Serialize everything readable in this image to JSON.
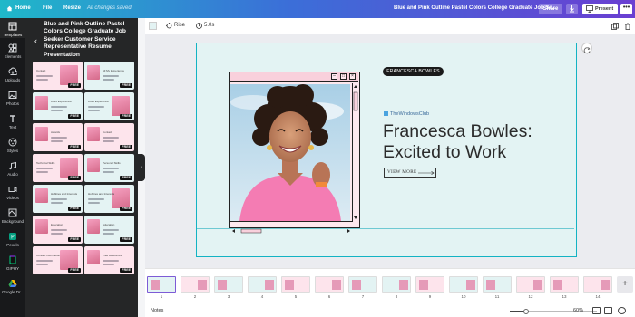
{
  "topbar": {
    "home": "Home",
    "file": "File",
    "resize": "Resize",
    "saved_status": "All changes saved",
    "doc_title": "Blue and Pink Outline Pastel Colors College Graduate Job Se...",
    "share": "Share",
    "present": "Present",
    "more": "•••"
  },
  "siderail": {
    "items": [
      {
        "label": "Templates",
        "icon": "templates-icon",
        "active": true
      },
      {
        "label": "Elements",
        "icon": "elements-icon"
      },
      {
        "label": "Uploads",
        "icon": "uploads-icon"
      },
      {
        "label": "Photos",
        "icon": "photos-icon"
      },
      {
        "label": "Text",
        "icon": "text-icon"
      },
      {
        "label": "Styles",
        "icon": "styles-icon"
      },
      {
        "label": "Audio",
        "icon": "audio-icon"
      },
      {
        "label": "Videos",
        "icon": "videos-icon"
      },
      {
        "label": "Background",
        "icon": "background-icon"
      },
      {
        "label": "Pexels",
        "icon": "pexels-icon"
      },
      {
        "label": "GIPHY",
        "icon": "giphy-icon"
      },
      {
        "label": "Google Dr...",
        "icon": "google-drive-icon"
      }
    ]
  },
  "panel": {
    "title": "Blue and Pink Outline Pastel Colors College Graduate Job Seeker Customer Service Representative Resume Presentation",
    "badge": "FREE",
    "thumbs": [
      {
        "label": "Contact",
        "bg": "#fde4ec"
      },
      {
        "label": "All My Experience",
        "bg": "#e4f3f3"
      },
      {
        "label": "Work Experience",
        "bg": "#e4f3f3"
      },
      {
        "label": "Work Experience",
        "bg": "#e4f3f3"
      },
      {
        "label": "Awards",
        "bg": "#fde4ec"
      },
      {
        "label": "Contact",
        "bg": "#fde4ec"
      },
      {
        "label": "Technical Skills",
        "bg": "#fde4ec"
      },
      {
        "label": "Personal Skills",
        "bg": "#e4f3f3"
      },
      {
        "label": "Hobbies and Interests",
        "bg": "#e4f3f3"
      },
      {
        "label": "Hobbies and Interests",
        "bg": "#e4f3f3"
      },
      {
        "label": "Education",
        "bg": "#fde4ec"
      },
      {
        "label": "Education",
        "bg": "#e4f3f3"
      },
      {
        "label": "Contact Information",
        "bg": "#fde4ec"
      },
      {
        "label": "Free Resources",
        "bg": "#fde4ec"
      }
    ]
  },
  "toolbar": {
    "animate": "Rise",
    "duration": "5.0s"
  },
  "slide": {
    "name_pill": "FRANCESCA BOWLES",
    "watermark": "TheWindowsClub",
    "headline_line1": "Francesca Bowles:",
    "headline_line2": "Excited to Work",
    "cta": "VIEW MORE",
    "window_buttons": [
      "–",
      "□",
      "×"
    ],
    "colors": {
      "canvas_bg": "#e3f3f3",
      "window_bg": "#fde8ee",
      "accent_teal": "#13b3c3",
      "pill_bg": "#1a1a1a"
    }
  },
  "filmstrip": {
    "pages": [
      "1",
      "2",
      "3",
      "4",
      "5",
      "6",
      "7",
      "8",
      "9",
      "10",
      "11",
      "12",
      "13",
      "14"
    ],
    "active_page": 1,
    "add_label": "+"
  },
  "statusbar": {
    "notes": "Notes",
    "zoom": "60%",
    "zoom_fraction": 0.6
  }
}
